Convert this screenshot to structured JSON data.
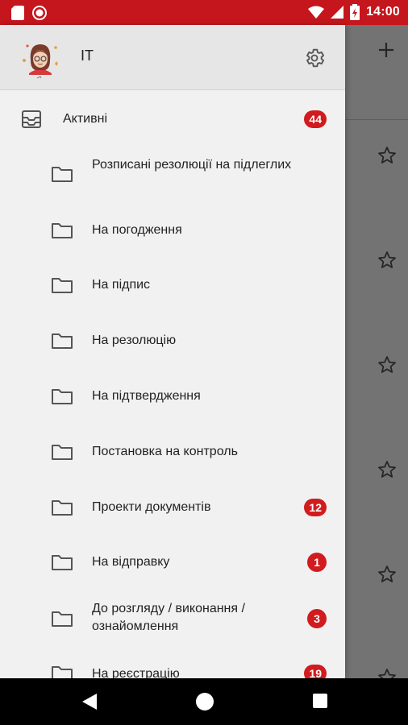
{
  "status": {
    "time": "14:00"
  },
  "drawer": {
    "user_name": "IT",
    "active": {
      "label": "Активні",
      "count": "44"
    },
    "items": [
      {
        "label": "Розписані резолюції на підлеглих",
        "badge": ""
      },
      {
        "label": "На погодження",
        "badge": ""
      },
      {
        "label": "На підпис",
        "badge": ""
      },
      {
        "label": "На резолюцію",
        "badge": ""
      },
      {
        "label": "На підтвердження",
        "badge": ""
      },
      {
        "label": "Постановка на контроль",
        "badge": ""
      },
      {
        "label": "Проекти документів",
        "badge": "12"
      },
      {
        "label": "На відправку",
        "badge": "1"
      },
      {
        "label": "До розгляду / виконання / ознайомлення",
        "badge": "3"
      },
      {
        "label": "На реєстрацію",
        "badge": "19"
      }
    ]
  },
  "colors": {
    "accent": "#c4161c",
    "badge": "#d11b1e"
  },
  "icons": [
    "sd-card-icon",
    "record-icon",
    "wifi-icon",
    "signal-icon",
    "battery-icon",
    "settings-icon",
    "inbox-icon",
    "folder-icon",
    "star-icon",
    "plus-icon",
    "back-icon",
    "home-icon",
    "recents-icon"
  ]
}
